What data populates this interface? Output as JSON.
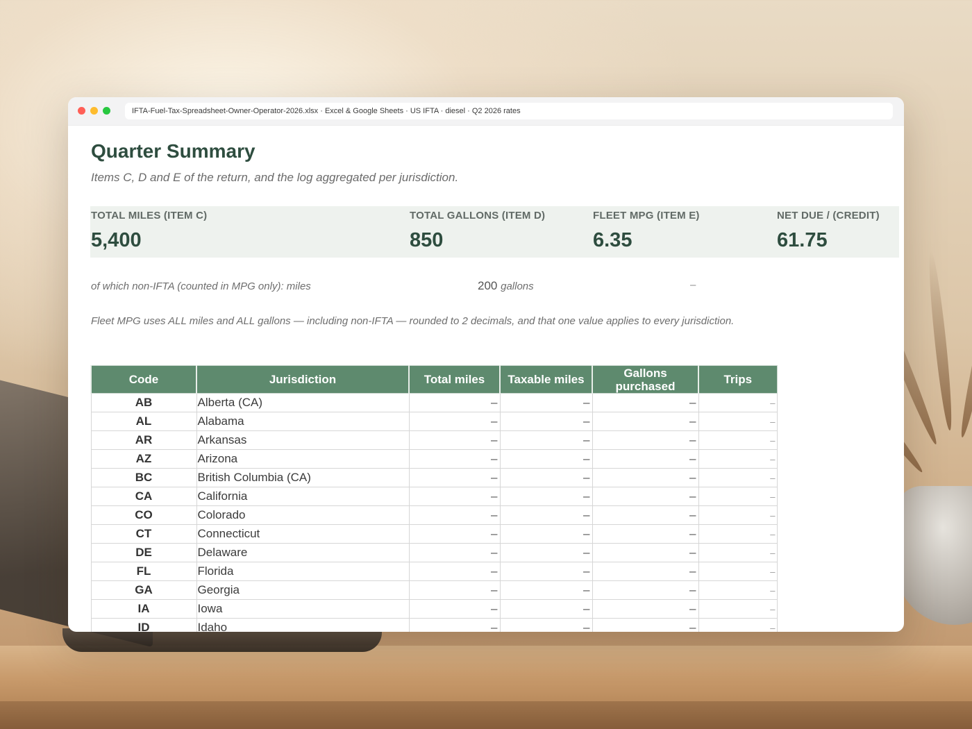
{
  "window": {
    "address": "IFTA-Fuel-Tax-Spreadsheet-Owner-Operator-2026.xlsx · Excel & Google Sheets · US IFTA · diesel · Q2 2026 rates"
  },
  "summary": {
    "title": "Quarter Summary",
    "subtitle": "Items C, D and E of the return, and the log aggregated per jurisdiction.",
    "kpis": [
      {
        "label": "TOTAL MILES (ITEM C)",
        "value": "5,400"
      },
      {
        "label": "TOTAL GALLONS (ITEM D)",
        "value": "850"
      },
      {
        "label": "FLEET MPG (ITEM E)",
        "value": "6.35"
      },
      {
        "label": "NET DUE / (CREDIT)",
        "value": "61.75"
      }
    ],
    "nonifta_label": "of which non-IFTA (counted in MPG only):  miles",
    "nonifta_gallons_value": "200",
    "nonifta_gallons_unit": "gallons",
    "nonifta_net": "–",
    "mpg_note": "Fleet MPG uses ALL miles and ALL gallons — including non-IFTA — rounded to 2 decimals, and that one value applies to every jurisdiction."
  },
  "table": {
    "headers": {
      "code": "Code",
      "jurisdiction": "Jurisdiction",
      "total_miles": "Total miles",
      "taxable_miles": "Taxable miles",
      "gallons_purchased": "Gallons purchased",
      "trips": "Trips"
    },
    "rows": [
      {
        "code": "AB",
        "name": "Alberta (CA)",
        "total": "–",
        "taxable": "–",
        "gallons": "–",
        "trips": "–"
      },
      {
        "code": "AL",
        "name": "Alabama",
        "total": "–",
        "taxable": "–",
        "gallons": "–",
        "trips": "–"
      },
      {
        "code": "AR",
        "name": "Arkansas",
        "total": "–",
        "taxable": "–",
        "gallons": "–",
        "trips": "–"
      },
      {
        "code": "AZ",
        "name": "Arizona",
        "total": "–",
        "taxable": "–",
        "gallons": "–",
        "trips": "–"
      },
      {
        "code": "BC",
        "name": "British Columbia (CA)",
        "total": "–",
        "taxable": "–",
        "gallons": "–",
        "trips": "–"
      },
      {
        "code": "CA",
        "name": "California",
        "total": "–",
        "taxable": "–",
        "gallons": "–",
        "trips": "–"
      },
      {
        "code": "CO",
        "name": "Colorado",
        "total": "–",
        "taxable": "–",
        "gallons": "–",
        "trips": "–"
      },
      {
        "code": "CT",
        "name": "Connecticut",
        "total": "–",
        "taxable": "–",
        "gallons": "–",
        "trips": "–"
      },
      {
        "code": "DE",
        "name": "Delaware",
        "total": "–",
        "taxable": "–",
        "gallons": "–",
        "trips": "–"
      },
      {
        "code": "FL",
        "name": "Florida",
        "total": "–",
        "taxable": "–",
        "gallons": "–",
        "trips": "–"
      },
      {
        "code": "GA",
        "name": "Georgia",
        "total": "–",
        "taxable": "–",
        "gallons": "–",
        "trips": "–"
      },
      {
        "code": "IA",
        "name": "Iowa",
        "total": "–",
        "taxable": "–",
        "gallons": "–",
        "trips": "–"
      },
      {
        "code": "ID",
        "name": "Idaho",
        "total": "–",
        "taxable": "–",
        "gallons": "–",
        "trips": "–"
      }
    ]
  },
  "colors": {
    "accent": "#2e4d3f",
    "header_fill": "#5e8a6e",
    "kpi_band": "#eef2ee"
  }
}
